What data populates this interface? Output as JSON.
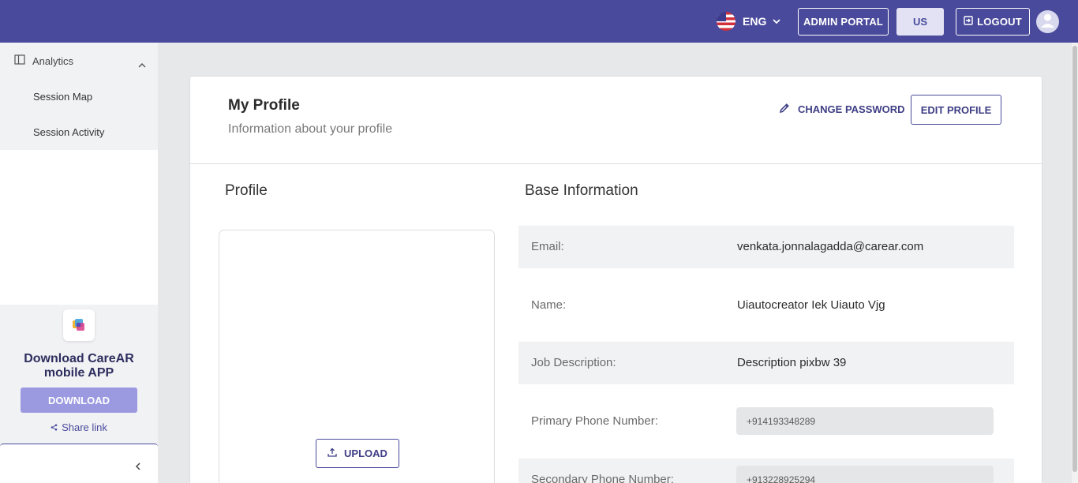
{
  "header": {
    "language": "ENG",
    "admin_portal": "ADMIN PORTAL",
    "region": "US",
    "logout": "LOGOUT",
    "bg_color": "#4a4a9c"
  },
  "sidebar": {
    "section": "Analytics",
    "items": [
      {
        "label": "Session Map"
      },
      {
        "label": "Session Activity"
      }
    ],
    "promo": {
      "title_line1": "Download CareAR",
      "title_line2": "mobile APP",
      "download": "DOWNLOAD",
      "share": "Share link"
    }
  },
  "profile": {
    "title": "My Profile",
    "subtitle": "Information about your profile",
    "change_password": "CHANGE PASSWORD",
    "edit_profile": "EDIT PROFILE",
    "section_profile": "Profile",
    "section_base": "Base Information",
    "upload": "UPLOAD",
    "fields": [
      {
        "label": "Email:",
        "value": "venkata.jonnalagadda@carear.com"
      },
      {
        "label": "Name:",
        "value": "Uiautocreator Iek Uiauto Vjg"
      },
      {
        "label": "Job Description:",
        "value": "Description pixbw 39"
      },
      {
        "label": "Primary Phone Number:",
        "value": "+914193348289"
      },
      {
        "label": "Secondary Phone Number:",
        "value": "+913228925294"
      }
    ]
  },
  "icons": {
    "flag": "us-flag-icon",
    "user": "user-icon",
    "logout": "logout-icon",
    "edit": "pencil-icon",
    "upload": "upload-icon",
    "share": "share-icon",
    "sidebar": "panel-icon"
  }
}
